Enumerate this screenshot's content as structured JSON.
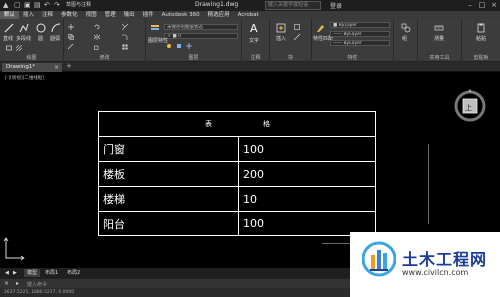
{
  "titlebar": {
    "qa_label": "草图与注释",
    "doc_title": "Drawing1.dwg",
    "search_placeholder": "键入关键字或短语",
    "login": "登录"
  },
  "menu": [
    "默认",
    "插入",
    "注释",
    "参数化",
    "视图",
    "管理",
    "输出",
    "插件",
    "Autodesk 360",
    "精选应用",
    "Acrobat"
  ],
  "ribbon": {
    "draw_group": "绘图",
    "modify_group": "修改",
    "annotate_group": "注释",
    "layers_group": "图层",
    "block_group": "块",
    "properties_group": "特性",
    "utilities_group": "实用工具",
    "clipboard_group": "剪贴板",
    "line": "直线",
    "polyline": "多段线",
    "circle": "圆",
    "arc": "圆弧",
    "text": "文字",
    "layer_props": "图层特性",
    "insert": "插入",
    "match": "特性匹配",
    "measure": "测量",
    "group": "组",
    "paste": "粘贴",
    "layer_combo": "未保存的图层状态",
    "bylayer1": "ByLayer",
    "bylayer2": "ByLayer",
    "bylayer3": "ByLayer"
  },
  "filetab": {
    "label": "Drawing1*"
  },
  "view_label": "[-][俯视][二维线框]",
  "viewcube_label": "上",
  "table": {
    "header": [
      "表",
      "格"
    ],
    "rows": [
      [
        "门窗",
        "100"
      ],
      [
        "楼板",
        "200"
      ],
      [
        "楼梯",
        "10"
      ],
      [
        "阳台",
        "100"
      ]
    ]
  },
  "watermark": {
    "title": "土木工程网",
    "url": "www.civilcn.com"
  },
  "layout_tabs": [
    "模型",
    "布局1",
    "布局2"
  ],
  "command": {
    "placeholder": "键入命令"
  },
  "coords": "2637.5225, 1880.5217, 0.0000"
}
